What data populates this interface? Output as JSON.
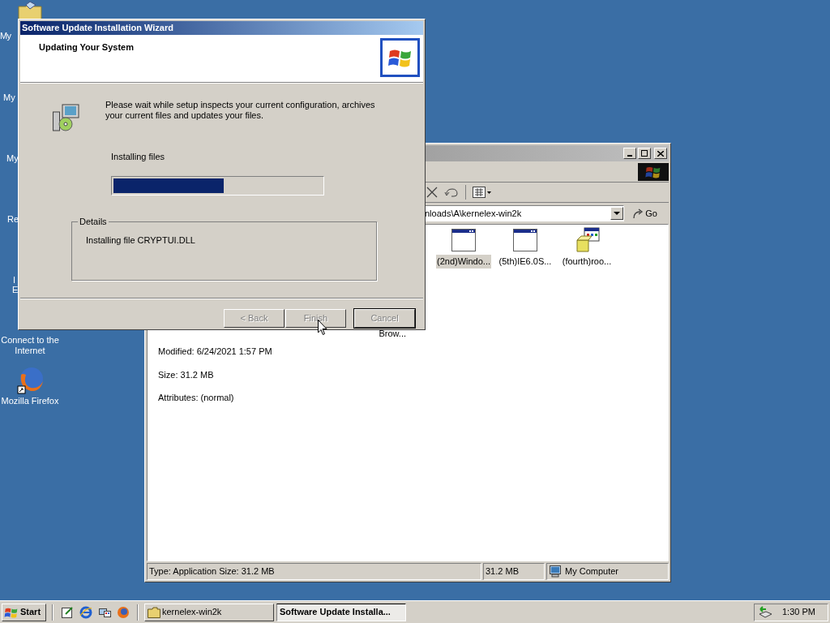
{
  "desktop": {
    "icons": [
      {
        "label": "My"
      },
      {
        "label": "My"
      },
      {
        "label": "My"
      },
      {
        "label": "Re"
      },
      {
        "label": "I"
      },
      {
        "label": "E"
      },
      {
        "label": "Connect to the Internet"
      },
      {
        "label": "Mozilla Firefox"
      }
    ]
  },
  "explorer": {
    "address": "nloads\\A\\kernelex-win2k",
    "go": "Go",
    "details": {
      "cut_label": "Brow...",
      "lines": [
        "Modified: 6/24/2021 1:57 PM",
        "Size: 31.2 MB",
        "Attributes: (normal)"
      ]
    },
    "files": [
      {
        "name": "(2nd)Windo...",
        "selected": true,
        "kind": "window"
      },
      {
        "name": "(5th)IE6.0S...",
        "selected": false,
        "kind": "window"
      },
      {
        "name": "(fourth)roo...",
        "selected": false,
        "kind": "installer"
      }
    ],
    "status_bar": [
      "Type: Application Size: 31.2 MB",
      "31.2 MB",
      "My Computer"
    ]
  },
  "wizard": {
    "title": "Software Update Installation Wizard",
    "heading": "Updating Your System",
    "message": "Please wait while setup inspects your current configuration, archives your current files and updates your files.",
    "progress_label": "Installing files",
    "progress": {
      "level": 0.53
    },
    "details_title": "Details",
    "details_text": "Installing file CRYPTUI.DLL",
    "buttons": [
      {
        "label": "< Back",
        "disabled": true
      },
      {
        "label": "Finish",
        "disabled": true
      },
      {
        "label": "Cancel",
        "disabled": true
      }
    ]
  },
  "taskbar": {
    "start": "Start",
    "tasks": [
      {
        "label": "kernelex-win2k",
        "selected": false
      },
      {
        "label": "Software Update Installa...",
        "selected": true
      }
    ],
    "clock": "1:30 PM"
  }
}
